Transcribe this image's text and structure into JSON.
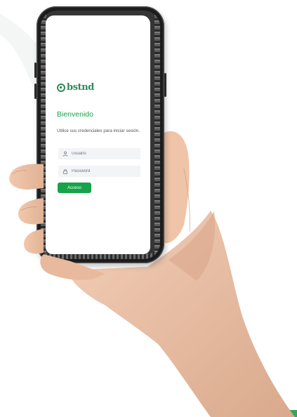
{
  "login": {
    "brand": "bstnd",
    "welcome": "Bienvenido",
    "subtitle": "Utilice sus credenciales para iniciar sesión.",
    "username_placeholder": "Usuario",
    "password_placeholder": "Password",
    "submit_label": "Acceso"
  },
  "colors": {
    "brand_green": "#2e8b57",
    "accent_green": "#16a34a",
    "field_bg": "#f3f4f6"
  },
  "icons": {
    "username": "user-icon",
    "password": "lock-icon",
    "logo": "brand-logo-icon"
  }
}
